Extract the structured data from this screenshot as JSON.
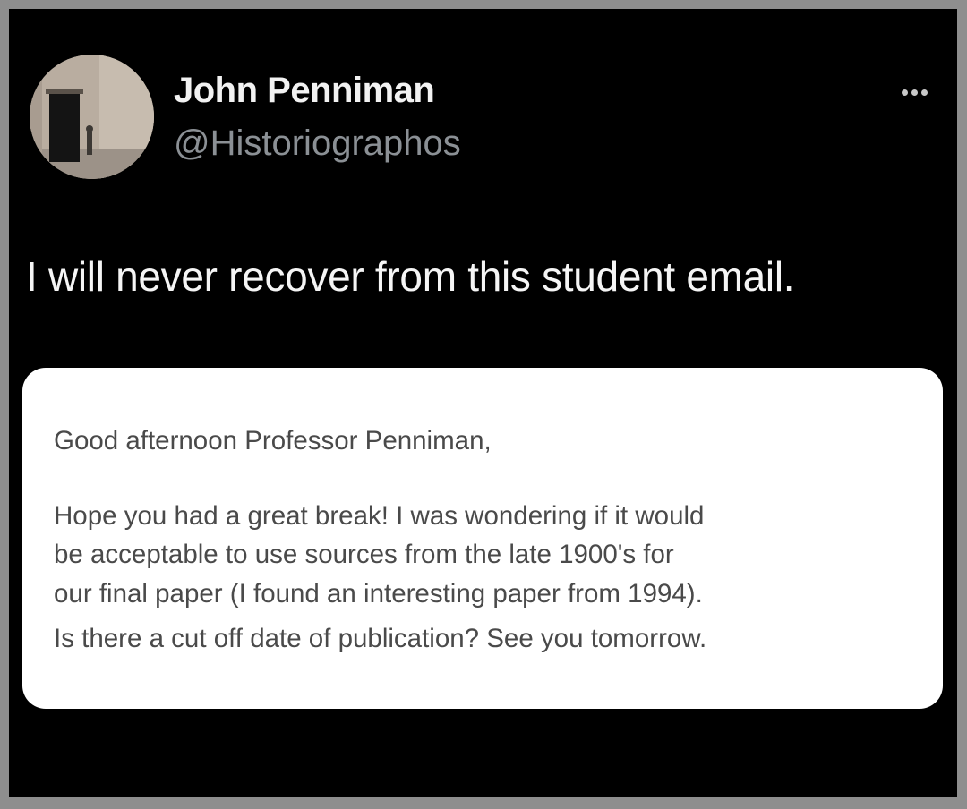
{
  "author": {
    "name": "John Penniman",
    "handle": "@Historiographos"
  },
  "tweet": {
    "text": "I will never recover from this student email."
  },
  "email": {
    "greeting": "Good afternoon Professor Penniman,",
    "body_lines": [
      "Hope you had a great break! I was wondering if it would",
      "be acceptable to use sources from the late 1900's for",
      "our final paper (I found an interesting paper from 1994).",
      "Is there a cut off date of publication? See you tomorrow."
    ]
  },
  "icons": {
    "more": "more-options-icon"
  },
  "colors": {
    "background": "#000000",
    "card": "#ffffff",
    "name": "#f2f2f2",
    "handle": "#8b9095",
    "email_text": "#4a4a4a",
    "border": "#8e8e8e"
  }
}
